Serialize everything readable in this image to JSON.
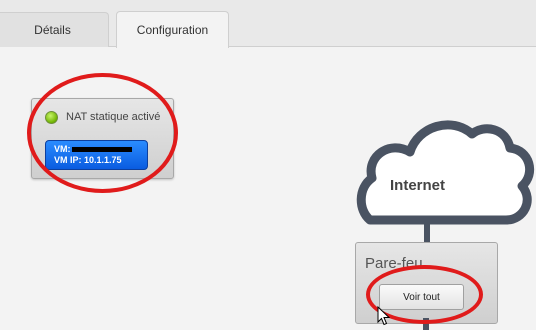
{
  "tabs": [
    {
      "label": "Détails"
    },
    {
      "label": "Configuration"
    }
  ],
  "nat": {
    "status_label": "NAT statique activé",
    "status_color": "#7bc21a",
    "vm_line1": "VM:",
    "vm_line2": "VM IP: 10.1.1.75"
  },
  "network": {
    "cloud_label": "Internet",
    "firewall_label": "Pare-feu",
    "view_all_label": "Voir tout"
  },
  "annotation_color": "#e01b1b"
}
